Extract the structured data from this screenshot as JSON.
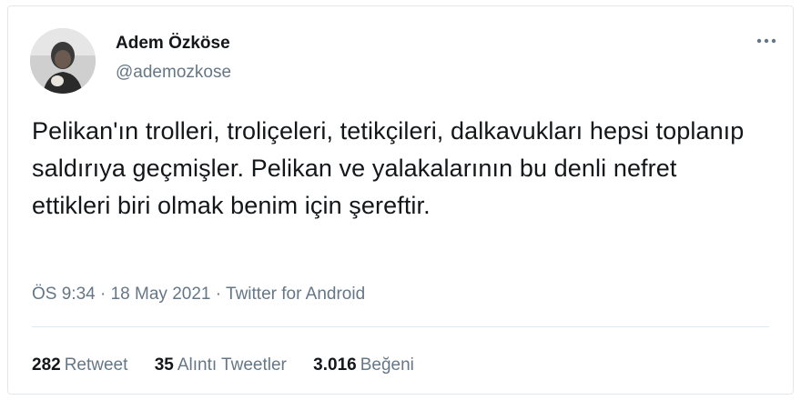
{
  "author": {
    "name": "Adem Özköse",
    "handle": "@ademozkose"
  },
  "tweet": {
    "text": "Pelikan'ın trolleri, troliçeleri, tetikçileri, dalkavukları hepsi toplanıp saldırıya geçmişler. Pelikan ve yalakalarının bu denli nefret ettikleri biri olmak benim için şereftir."
  },
  "meta": {
    "time": "ÖS 9:34",
    "date": "18 May 2021",
    "source": "Twitter for Android",
    "separator": "·"
  },
  "stats": {
    "retweets": {
      "count": "282",
      "label": "Retweet"
    },
    "quotes": {
      "count": "35",
      "label": "Alıntı Tweetler"
    },
    "likes": {
      "count": "3.016",
      "label": "Beğeni"
    }
  },
  "icons": {
    "more": "more-horizontal-icon"
  },
  "colors": {
    "text": "#14171a",
    "secondary": "#657786",
    "border": "#e1e8ed"
  }
}
